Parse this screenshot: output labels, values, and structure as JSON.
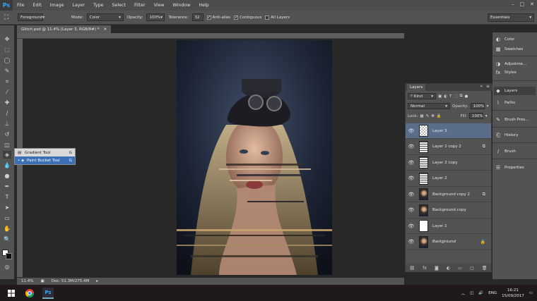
{
  "app": {
    "logo": "Ps",
    "window_controls": [
      "–",
      "□",
      "✕"
    ]
  },
  "menu": [
    "File",
    "Edit",
    "Image",
    "Layer",
    "Type",
    "Select",
    "Filter",
    "View",
    "Window",
    "Help"
  ],
  "options": {
    "fill_source": "Foreground",
    "mode_label": "Mode:",
    "mode_value": "Color",
    "opacity_label": "Opacity:",
    "opacity_value": "100%",
    "tolerance_label": "Tolerance:",
    "tolerance_value": "32",
    "antialias": "Anti-alias",
    "contiguous": "Contiguous",
    "all_layers": "All Layers",
    "workspace": "Essentials"
  },
  "document": {
    "tab_title": "Glitch.psd @ 11.4% (Layer 3, RGB/8#) *",
    "zoom": "11.4%",
    "doc_info": "Doc: 51.3M/275.4M"
  },
  "flyout": [
    {
      "label": "Gradient Tool",
      "key": "G",
      "selected": false
    },
    {
      "label": "Paint Bucket Tool",
      "key": "G",
      "selected": true
    }
  ],
  "dock": [
    {
      "label": "Color",
      "icon": "color-icon"
    },
    {
      "label": "Swatches",
      "icon": "swatches-icon"
    },
    {
      "label": "Adjustme...",
      "icon": "adjustments-icon"
    },
    {
      "label": "Styles",
      "icon": "styles-icon"
    },
    {
      "label": "Layers",
      "icon": "layers-icon"
    },
    {
      "label": "Paths",
      "icon": "paths-icon"
    },
    {
      "label": "Brush Pres...",
      "icon": "brush-presets-icon"
    },
    {
      "label": "History",
      "icon": "history-icon"
    },
    {
      "label": "Brush",
      "icon": "brush-icon"
    },
    {
      "label": "Properties",
      "icon": "properties-icon"
    }
  ],
  "layers_panel": {
    "tab": "Layers",
    "kind_label": "Kind",
    "blend_mode": "Normal",
    "opacity_label": "Opacity:",
    "opacity_value": "100%",
    "lock_label": "Lock:",
    "fill_label": "Fill:",
    "fill_value": "100%",
    "layers": [
      {
        "name": "Layer 3",
        "thumb": "checker",
        "selected": true,
        "badge": ""
      },
      {
        "name": "Layer 2 copy 2",
        "thumb": "stripes",
        "selected": false,
        "badge": "⧉"
      },
      {
        "name": "Layer 2 copy",
        "thumb": "stripes",
        "selected": false,
        "badge": ""
      },
      {
        "name": "Layer 2",
        "thumb": "stripes",
        "selected": false,
        "badge": ""
      },
      {
        "name": "Background copy 2",
        "thumb": "photo",
        "selected": false,
        "badge": "⧉"
      },
      {
        "name": "Background copy",
        "thumb": "photo",
        "selected": false,
        "badge": ""
      },
      {
        "name": "Layer 1",
        "thumb": "white",
        "selected": false,
        "badge": ""
      },
      {
        "name": "Background",
        "thumb": "photo",
        "selected": false,
        "badge": "🔒"
      }
    ]
  },
  "taskbar": {
    "language": "ENG",
    "time": "16:21",
    "date": "15/09/2017"
  }
}
